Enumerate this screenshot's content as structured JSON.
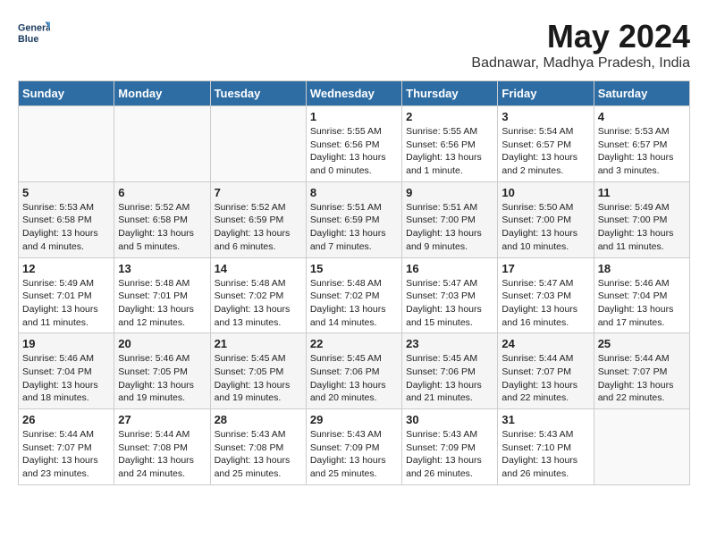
{
  "header": {
    "logo_line1": "General",
    "logo_line2": "Blue",
    "title": "May 2024",
    "location": "Badnawar, Madhya Pradesh, India"
  },
  "days_of_week": [
    "Sunday",
    "Monday",
    "Tuesday",
    "Wednesday",
    "Thursday",
    "Friday",
    "Saturday"
  ],
  "weeks": [
    [
      {
        "day": "",
        "info": ""
      },
      {
        "day": "",
        "info": ""
      },
      {
        "day": "",
        "info": ""
      },
      {
        "day": "1",
        "info": "Sunrise: 5:55 AM\nSunset: 6:56 PM\nDaylight: 13 hours and 0 minutes."
      },
      {
        "day": "2",
        "info": "Sunrise: 5:55 AM\nSunset: 6:56 PM\nDaylight: 13 hours and 1 minute."
      },
      {
        "day": "3",
        "info": "Sunrise: 5:54 AM\nSunset: 6:57 PM\nDaylight: 13 hours and 2 minutes."
      },
      {
        "day": "4",
        "info": "Sunrise: 5:53 AM\nSunset: 6:57 PM\nDaylight: 13 hours and 3 minutes."
      }
    ],
    [
      {
        "day": "5",
        "info": "Sunrise: 5:53 AM\nSunset: 6:58 PM\nDaylight: 13 hours and 4 minutes."
      },
      {
        "day": "6",
        "info": "Sunrise: 5:52 AM\nSunset: 6:58 PM\nDaylight: 13 hours and 5 minutes."
      },
      {
        "day": "7",
        "info": "Sunrise: 5:52 AM\nSunset: 6:59 PM\nDaylight: 13 hours and 6 minutes."
      },
      {
        "day": "8",
        "info": "Sunrise: 5:51 AM\nSunset: 6:59 PM\nDaylight: 13 hours and 7 minutes."
      },
      {
        "day": "9",
        "info": "Sunrise: 5:51 AM\nSunset: 7:00 PM\nDaylight: 13 hours and 9 minutes."
      },
      {
        "day": "10",
        "info": "Sunrise: 5:50 AM\nSunset: 7:00 PM\nDaylight: 13 hours and 10 minutes."
      },
      {
        "day": "11",
        "info": "Sunrise: 5:49 AM\nSunset: 7:00 PM\nDaylight: 13 hours and 11 minutes."
      }
    ],
    [
      {
        "day": "12",
        "info": "Sunrise: 5:49 AM\nSunset: 7:01 PM\nDaylight: 13 hours and 11 minutes."
      },
      {
        "day": "13",
        "info": "Sunrise: 5:48 AM\nSunset: 7:01 PM\nDaylight: 13 hours and 12 minutes."
      },
      {
        "day": "14",
        "info": "Sunrise: 5:48 AM\nSunset: 7:02 PM\nDaylight: 13 hours and 13 minutes."
      },
      {
        "day": "15",
        "info": "Sunrise: 5:48 AM\nSunset: 7:02 PM\nDaylight: 13 hours and 14 minutes."
      },
      {
        "day": "16",
        "info": "Sunrise: 5:47 AM\nSunset: 7:03 PM\nDaylight: 13 hours and 15 minutes."
      },
      {
        "day": "17",
        "info": "Sunrise: 5:47 AM\nSunset: 7:03 PM\nDaylight: 13 hours and 16 minutes."
      },
      {
        "day": "18",
        "info": "Sunrise: 5:46 AM\nSunset: 7:04 PM\nDaylight: 13 hours and 17 minutes."
      }
    ],
    [
      {
        "day": "19",
        "info": "Sunrise: 5:46 AM\nSunset: 7:04 PM\nDaylight: 13 hours and 18 minutes."
      },
      {
        "day": "20",
        "info": "Sunrise: 5:46 AM\nSunset: 7:05 PM\nDaylight: 13 hours and 19 minutes."
      },
      {
        "day": "21",
        "info": "Sunrise: 5:45 AM\nSunset: 7:05 PM\nDaylight: 13 hours and 19 minutes."
      },
      {
        "day": "22",
        "info": "Sunrise: 5:45 AM\nSunset: 7:06 PM\nDaylight: 13 hours and 20 minutes."
      },
      {
        "day": "23",
        "info": "Sunrise: 5:45 AM\nSunset: 7:06 PM\nDaylight: 13 hours and 21 minutes."
      },
      {
        "day": "24",
        "info": "Sunrise: 5:44 AM\nSunset: 7:07 PM\nDaylight: 13 hours and 22 minutes."
      },
      {
        "day": "25",
        "info": "Sunrise: 5:44 AM\nSunset: 7:07 PM\nDaylight: 13 hours and 22 minutes."
      }
    ],
    [
      {
        "day": "26",
        "info": "Sunrise: 5:44 AM\nSunset: 7:07 PM\nDaylight: 13 hours and 23 minutes."
      },
      {
        "day": "27",
        "info": "Sunrise: 5:44 AM\nSunset: 7:08 PM\nDaylight: 13 hours and 24 minutes."
      },
      {
        "day": "28",
        "info": "Sunrise: 5:43 AM\nSunset: 7:08 PM\nDaylight: 13 hours and 25 minutes."
      },
      {
        "day": "29",
        "info": "Sunrise: 5:43 AM\nSunset: 7:09 PM\nDaylight: 13 hours and 25 minutes."
      },
      {
        "day": "30",
        "info": "Sunrise: 5:43 AM\nSunset: 7:09 PM\nDaylight: 13 hours and 26 minutes."
      },
      {
        "day": "31",
        "info": "Sunrise: 5:43 AM\nSunset: 7:10 PM\nDaylight: 13 hours and 26 minutes."
      },
      {
        "day": "",
        "info": ""
      }
    ]
  ]
}
